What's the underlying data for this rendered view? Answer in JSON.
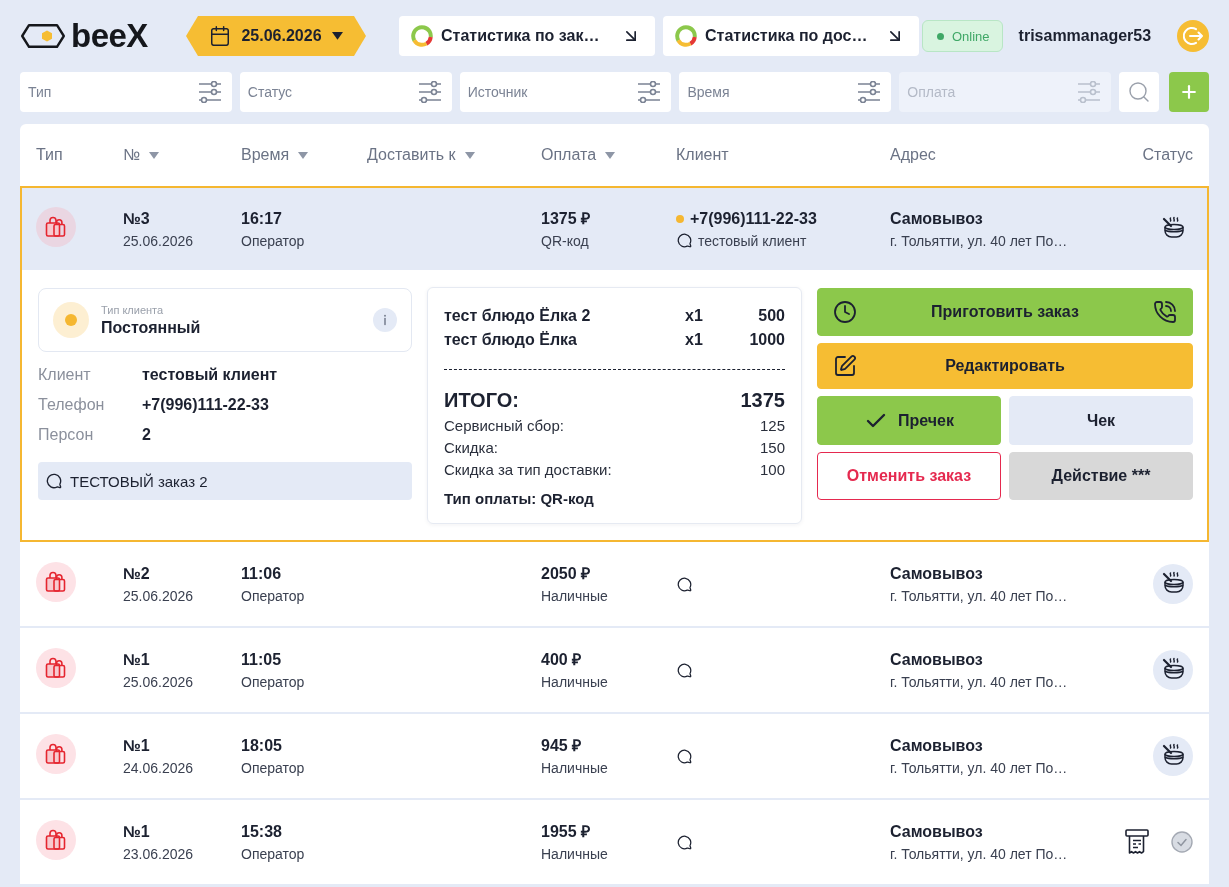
{
  "header": {
    "logo": "beeX",
    "date": "25.06.2026",
    "stats": [
      {
        "label": "Статистика по зак…"
      },
      {
        "label": "Статистика по дос…"
      }
    ],
    "connection": "Online",
    "username": "trisammanager53"
  },
  "filters": [
    {
      "placeholder": "Тип",
      "disabled": false
    },
    {
      "placeholder": "Статус",
      "disabled": false
    },
    {
      "placeholder": "Источник",
      "disabled": false
    },
    {
      "placeholder": "Время",
      "disabled": false
    },
    {
      "placeholder": "Оплата",
      "disabled": true
    }
  ],
  "table": {
    "columns": [
      {
        "label": "Тип",
        "sortable": false
      },
      {
        "label": "№",
        "sortable": true
      },
      {
        "label": "Время",
        "sortable": true
      },
      {
        "label": "Доставить к",
        "sortable": true
      },
      {
        "label": "Оплата",
        "sortable": true
      },
      {
        "label": "Клиент",
        "sortable": false
      },
      {
        "label": "Адрес",
        "sortable": false
      },
      {
        "label": "Статус",
        "sortable": false
      }
    ],
    "rows": [
      {
        "selected": true,
        "number": "№3",
        "date": "25.06.2026",
        "time": "16:17",
        "source": "Оператор",
        "amount": "1375 ₽",
        "payment": "QR-код",
        "client": {
          "phone": "+7(996)111-22-33",
          "name": "тестовый клиент",
          "color": "#f5b731"
        },
        "delivery": "Самовывоз",
        "address": "г. Тольятти, ул. 40 лет По…",
        "status": {
          "kind": "cooking"
        },
        "details": {
          "client_type": {
            "label": "Тип клиента",
            "value": "Постоянный",
            "color": "#f5b731"
          },
          "info": [
            {
              "label": "Клиент",
              "value": "тестовый клиент"
            },
            {
              "label": "Телефон",
              "value": "+7(996)111-22-33"
            },
            {
              "label": "Персон",
              "value": "2"
            }
          ],
          "comment": "ТЕСТОВЫЙ заказ 2",
          "receipt": {
            "items": [
              {
                "name": "тест блюдо Ёлка 2",
                "qty": "x1",
                "price": "500"
              },
              {
                "name": "тест блюдо Ёлка",
                "qty": "x1",
                "price": "1000"
              }
            ],
            "total_label": "ИТОГО:",
            "total": "1375",
            "charges": [
              {
                "label": "Сервисный сбор:",
                "value": "125"
              },
              {
                "label": "Скидка:",
                "value": "150"
              },
              {
                "label": "Скидка за тип доставки:",
                "value": "100"
              }
            ],
            "payment": "Тип оплаты: QR-код"
          },
          "actions": [
            {
              "label": "Приготовить заказ",
              "kind": "prepare"
            },
            {
              "label": "Редактировать",
              "kind": "edit"
            },
            {
              "label": "Пречек",
              "kind": "precheck"
            },
            {
              "label": "Чек",
              "kind": "check"
            },
            {
              "label": "Отменить заказ",
              "kind": "cancel"
            },
            {
              "label": "Действие ***",
              "kind": "more"
            }
          ]
        }
      },
      {
        "selected": false,
        "number": "№2",
        "date": "25.06.2026",
        "time": "11:06",
        "source": "Оператор",
        "amount": "2050 ₽",
        "payment": "Наличные",
        "delivery": "Самовывоз",
        "address": "г. Тольятти, ул. 40 лет По…",
        "status": {
          "kind": "cooking"
        }
      },
      {
        "selected": false,
        "number": "№1",
        "date": "25.06.2026",
        "time": "11:05",
        "source": "Оператор",
        "amount": "400 ₽",
        "payment": "Наличные",
        "delivery": "Самовывоз",
        "address": "г. Тольятти, ул. 40 лет По…",
        "status": {
          "kind": "cooking"
        }
      },
      {
        "selected": false,
        "number": "№1",
        "date": "24.06.2026",
        "time": "18:05",
        "source": "Оператор",
        "amount": "945 ₽",
        "payment": "Наличные",
        "delivery": "Самовывоз",
        "address": "г. Тольятти, ул. 40 лет По…",
        "status": {
          "kind": "cooking"
        }
      },
      {
        "selected": false,
        "number": "№1",
        "date": "23.06.2026",
        "time": "15:38",
        "source": "Оператор",
        "amount": "1955 ₽",
        "payment": "Наличные",
        "delivery": "Самовывоз",
        "address": "г. Тольятти, ул. 40 лет По…",
        "status": {
          "kind": "closed"
        }
      }
    ]
  }
}
